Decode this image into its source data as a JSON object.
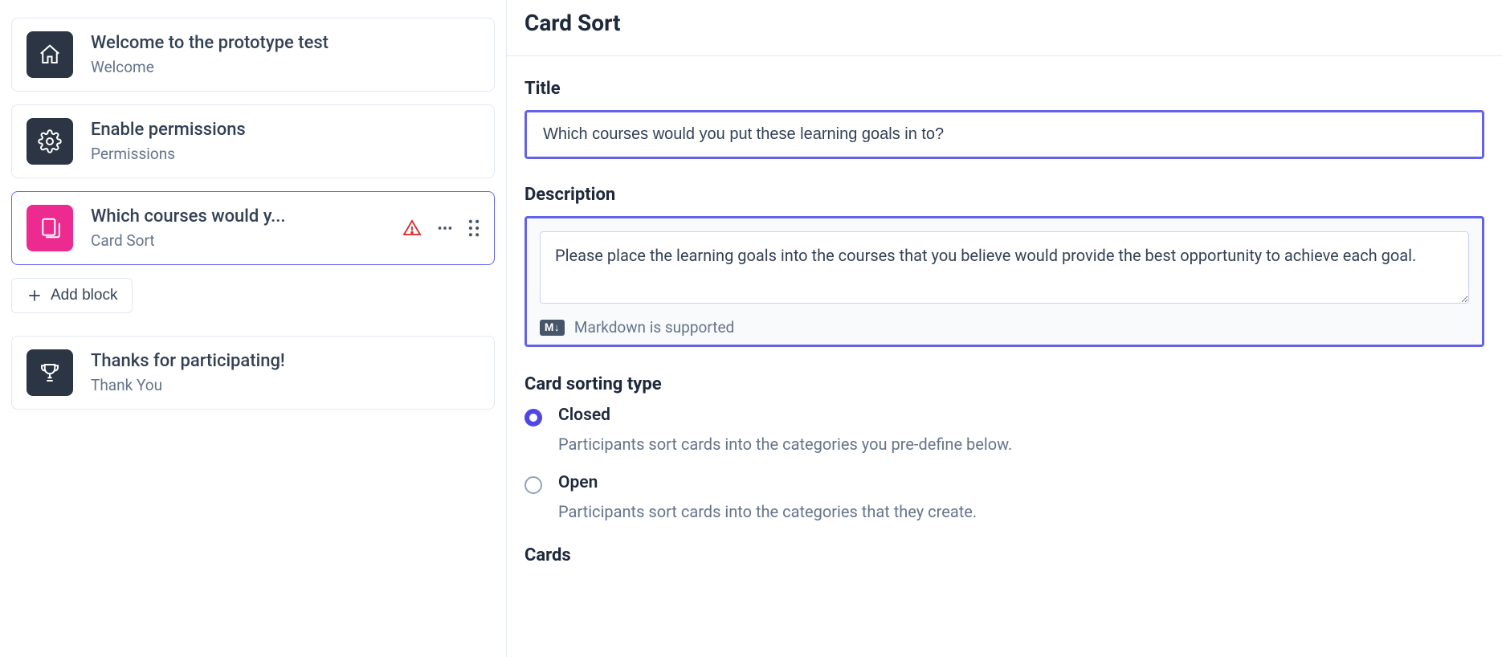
{
  "sidebar": {
    "items": [
      {
        "title": "Welcome to the prototype test",
        "subtitle": "Welcome",
        "icon": "home-icon",
        "iconStyle": "dark",
        "selected": false,
        "showActions": false
      },
      {
        "title": "Enable permissions",
        "subtitle": "Permissions",
        "icon": "gear-icon",
        "iconStyle": "dark",
        "selected": false,
        "showActions": false
      },
      {
        "title": "Which courses would y...",
        "subtitle": "Card Sort",
        "icon": "cards-icon",
        "iconStyle": "pink",
        "selected": true,
        "showActions": true
      },
      {
        "title": "Thanks for participating!",
        "subtitle": "Thank You",
        "icon": "trophy-icon",
        "iconStyle": "dark",
        "selected": false,
        "showActions": false
      }
    ],
    "addBlockLabel": "Add block"
  },
  "main": {
    "heading": "Card Sort",
    "titleField": {
      "label": "Title",
      "value": "Which courses would you put these learning goals in to?"
    },
    "descField": {
      "label": "Description",
      "value": "Please place the learning goals into the courses that you believe would provide the best opportunity to achieve each goal.",
      "hint": "Markdown is supported",
      "badge": "M↓"
    },
    "sortType": {
      "label": "Card sorting type",
      "options": [
        {
          "name": "Closed",
          "desc": "Participants sort cards into the categories you pre-define below.",
          "selected": true
        },
        {
          "name": "Open",
          "desc": "Participants sort cards into the categories that they create.",
          "selected": false
        }
      ]
    },
    "cardsLabel": "Cards"
  }
}
